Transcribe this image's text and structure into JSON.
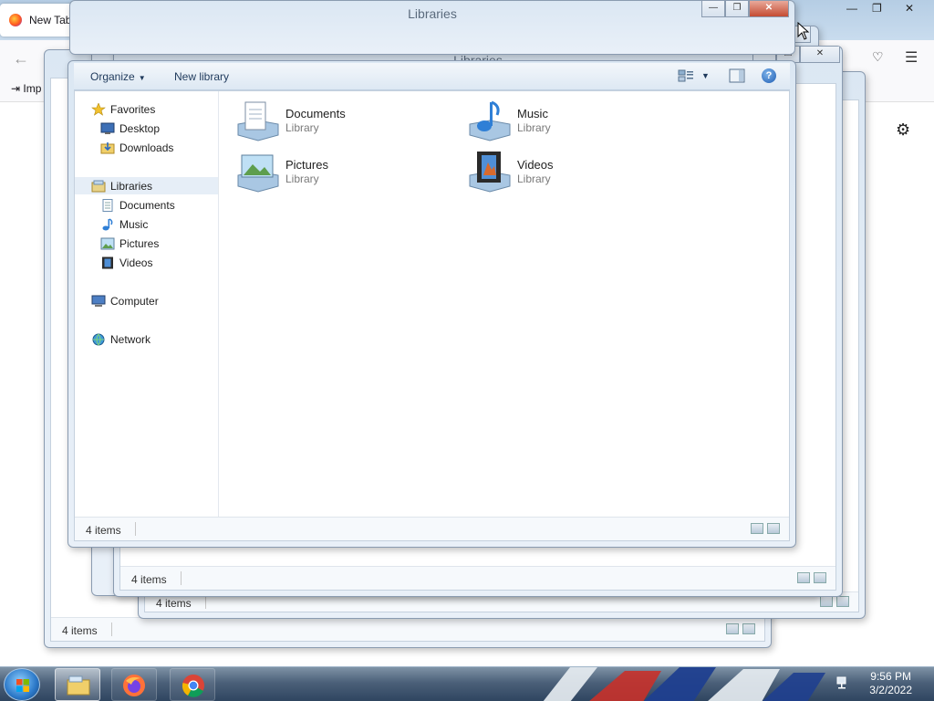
{
  "firefox": {
    "tab_title": "New Tab",
    "tab_close": "×",
    "import_label": "Imp",
    "back_icon": "back-arrow-icon",
    "winctl": {
      "minimize": "—",
      "restore": "❐",
      "close": "✕"
    }
  },
  "windows": {
    "title": "Libraries",
    "status": "4 items"
  },
  "explorer": {
    "toolbar": {
      "organize": "Organize",
      "new_library": "New library",
      "help": "?"
    },
    "nav": {
      "favorites": "Favorites",
      "desktop": "Desktop",
      "downloads": "Downloads",
      "libraries": "Libraries",
      "documents": "Documents",
      "music": "Music",
      "pictures": "Pictures",
      "videos": "Videos",
      "computer": "Computer",
      "network": "Network"
    },
    "libraries": [
      {
        "name": "Documents",
        "type": "Library",
        "icon": "documents-library-icon"
      },
      {
        "name": "Music",
        "type": "Library",
        "icon": "music-library-icon"
      },
      {
        "name": "Pictures",
        "type": "Library",
        "icon": "pictures-library-icon"
      },
      {
        "name": "Videos",
        "type": "Library",
        "icon": "videos-library-icon"
      }
    ],
    "status": "4 items"
  },
  "taskbar": {
    "time": "9:56 PM",
    "date": "3/2/2022",
    "apps": [
      "windows-explorer-icon",
      "firefox-icon",
      "chrome-icon"
    ]
  },
  "colors": {
    "title_text": "#5b6b7d",
    "toolbar_text": "#1e395b",
    "library_type_text": "#7a7a7a",
    "close_button": "#c44b32"
  }
}
